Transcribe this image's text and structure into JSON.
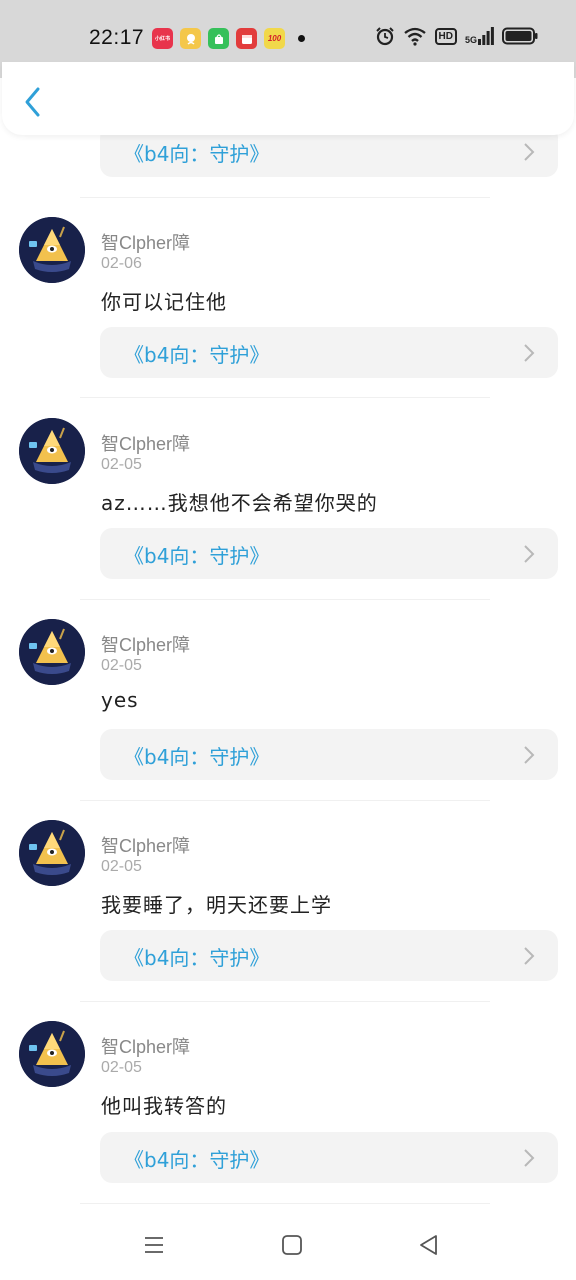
{
  "status_bar": {
    "time": "22:17",
    "app_icons": [
      {
        "name": "app-icon-1",
        "color": "#e8344c",
        "label": "小红书"
      },
      {
        "name": "app-icon-2",
        "color": "#f4c74a",
        "label": ""
      },
      {
        "name": "app-icon-3",
        "color": "#36c05a",
        "label": ""
      },
      {
        "name": "app-icon-4",
        "color": "#e23c3c",
        "label": ""
      },
      {
        "name": "app-icon-5",
        "color": "#f1d84a",
        "label": "100"
      }
    ],
    "network": "5G",
    "hd": "HD"
  },
  "top_card": {
    "link_text": "《b4向：守护》"
  },
  "comments": [
    {
      "username": "智Clpher障",
      "date": "02-06",
      "text": "你可以记住他",
      "link_text": "《b4向：守护》"
    },
    {
      "username": "智Clpher障",
      "date": "02-05",
      "text": "az……我想他不会希望你哭的",
      "link_text": "《b4向：守护》"
    },
    {
      "username": "智Clpher障",
      "date": "02-05",
      "text": "yes",
      "link_text": "《b4向：守护》"
    },
    {
      "username": "智Clpher障",
      "date": "02-05",
      "text": "我要睡了，明天还要上学",
      "link_text": "《b4向：守护》"
    },
    {
      "username": "智Clpher障",
      "date": "02-05",
      "text": "他叫我转答的",
      "link_text": "《b4向：守护》"
    }
  ],
  "colors": {
    "accent": "#2fa0d8",
    "card_bg": "#f3f3f3",
    "avatar_bg": "#18214a"
  }
}
